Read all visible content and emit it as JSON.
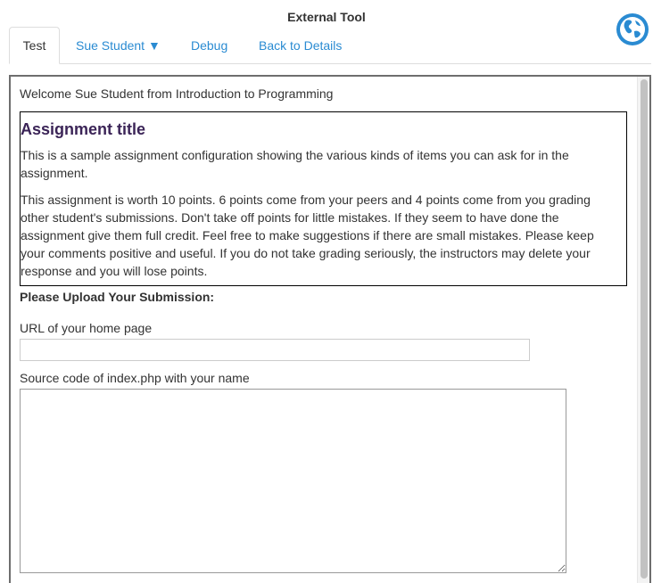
{
  "window": {
    "title": "External Tool"
  },
  "tabs": [
    {
      "label": "Test",
      "active": true
    },
    {
      "label": "Sue Student ▼",
      "active": false
    },
    {
      "label": "Debug",
      "active": false
    },
    {
      "label": "Back to Details",
      "active": false
    }
  ],
  "welcome": "Welcome Sue Student from Introduction to Programming",
  "assignment": {
    "title": "Assignment title",
    "paragraphs": [
      "This is a sample assignment configuration showing the various kinds of items you can ask for in the assignment.",
      "This assignment is worth 10 points. 6 points come from your peers and 4 points come from you grading other student's submissions. Don't take off points for little mistakes. If they seem to have done the assignment give them full credit. Feel free to make suggestions if there are small mistakes. Please keep your comments positive and useful. If you do not take grading seriously, the instructors may delete your response and you will lose points."
    ]
  },
  "form": {
    "heading": "Please Upload Your Submission:",
    "url_label": "URL of your home page",
    "url_value": "",
    "code_label": "Source code of index.php with your name",
    "code_value": ""
  },
  "colors": {
    "link": "#2a8bd2",
    "title": "#3b2457",
    "globe": "#2a8bd2"
  },
  "icons": {
    "globe": "globe-icon"
  }
}
